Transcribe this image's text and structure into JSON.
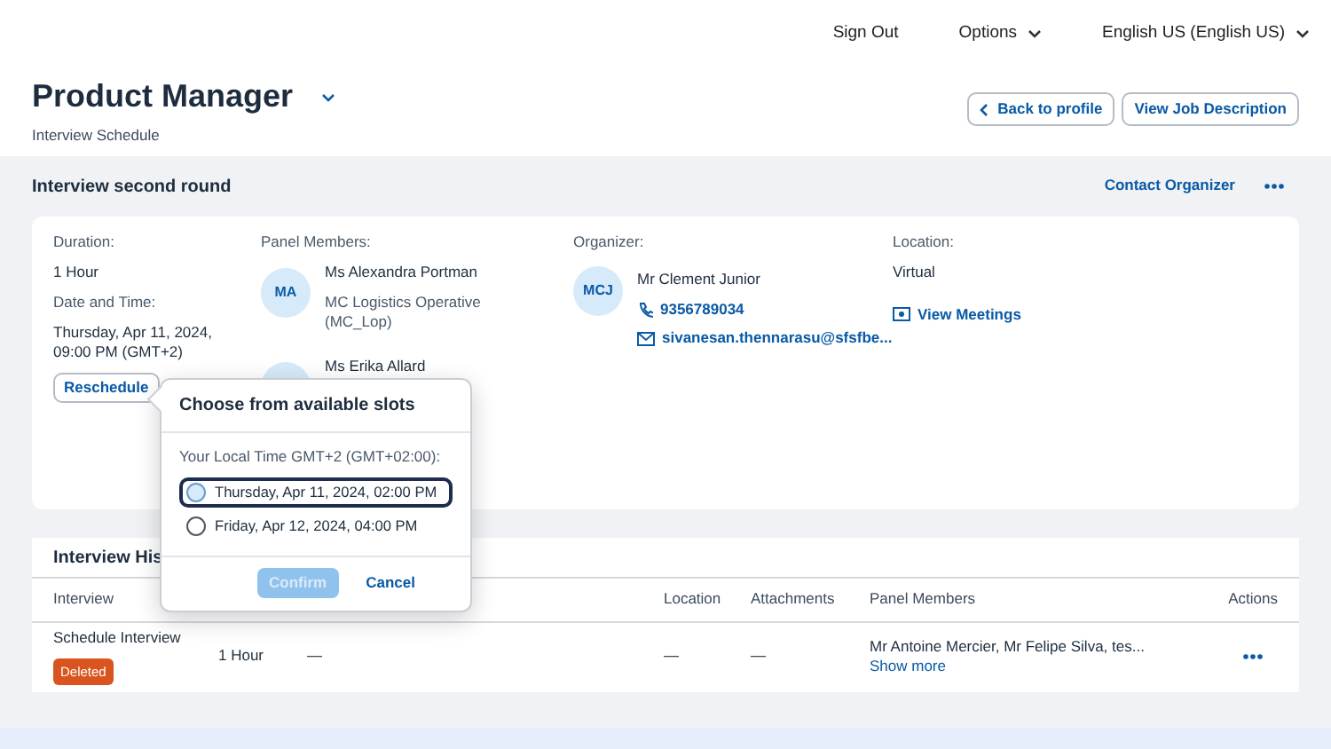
{
  "top_nav": [
    {
      "label": "Sign Out",
      "dropdown": false
    },
    {
      "label": "Options",
      "dropdown": true
    },
    {
      "label": "English US (English US)",
      "dropdown": true
    }
  ],
  "header": {
    "title": "Product Manager",
    "subtitle": "Interview Schedule",
    "buttons": [
      {
        "label": "Back to profile",
        "kind": "back"
      },
      {
        "label": "View Job Description",
        "kind": "plain"
      }
    ]
  },
  "interview": {
    "title": "Interview second round",
    "contact_link": "Contact Organizer",
    "duration_label": "Duration:",
    "duration": "1 Hour",
    "date_label": "Date and Time:",
    "date": "Thursday, Apr 11, 2024, 09:00 PM (GMT+2)",
    "reschedule": "Reschedule",
    "panel_label": "Panel Members:",
    "panel_members": [
      {
        "initials": "MA",
        "name": "Ms Alexandra Portman",
        "role": "MC Logistics Operative (MC_Lop)"
      },
      {
        "name": "Ms Erika Allard"
      }
    ],
    "organizer_label": "Organizer:",
    "organizer": {
      "initials": "MCJ",
      "name": "Mr Clement Junior",
      "phone": "9356789034",
      "email": "sivanesan.thennarasu@sfsfbe..."
    },
    "location_label": "Location:",
    "location": "Virtual",
    "meetings_link": "View Meetings"
  },
  "history": {
    "title": "Interview His",
    "columns": [
      "Interview",
      "Location",
      "Attachments",
      "Panel Members",
      "Actions"
    ],
    "rows": [
      {
        "interview": "Schedule Interview",
        "status": "Deleted",
        "duration": "1 Hour",
        "column_3": "—",
        "location": "—",
        "attachments": "—",
        "panel_members": "Mr Antoine Mercier, Mr Felipe Silva, tes...",
        "show_more": "Show more"
      }
    ]
  },
  "popover": {
    "title": "Choose from available slots",
    "timezone": "Your Local Time GMT+2 (GMT+02:00):",
    "slots": [
      {
        "label": "Thursday, Apr 11, 2024, 02:00 PM",
        "selected": false,
        "focused": true
      },
      {
        "label": "Friday, Apr 12, 2024, 04:00 PM",
        "selected": false,
        "focused": false
      }
    ],
    "confirm": {
      "label": "Confirm",
      "disabled": true
    },
    "cancel": "Cancel"
  }
}
